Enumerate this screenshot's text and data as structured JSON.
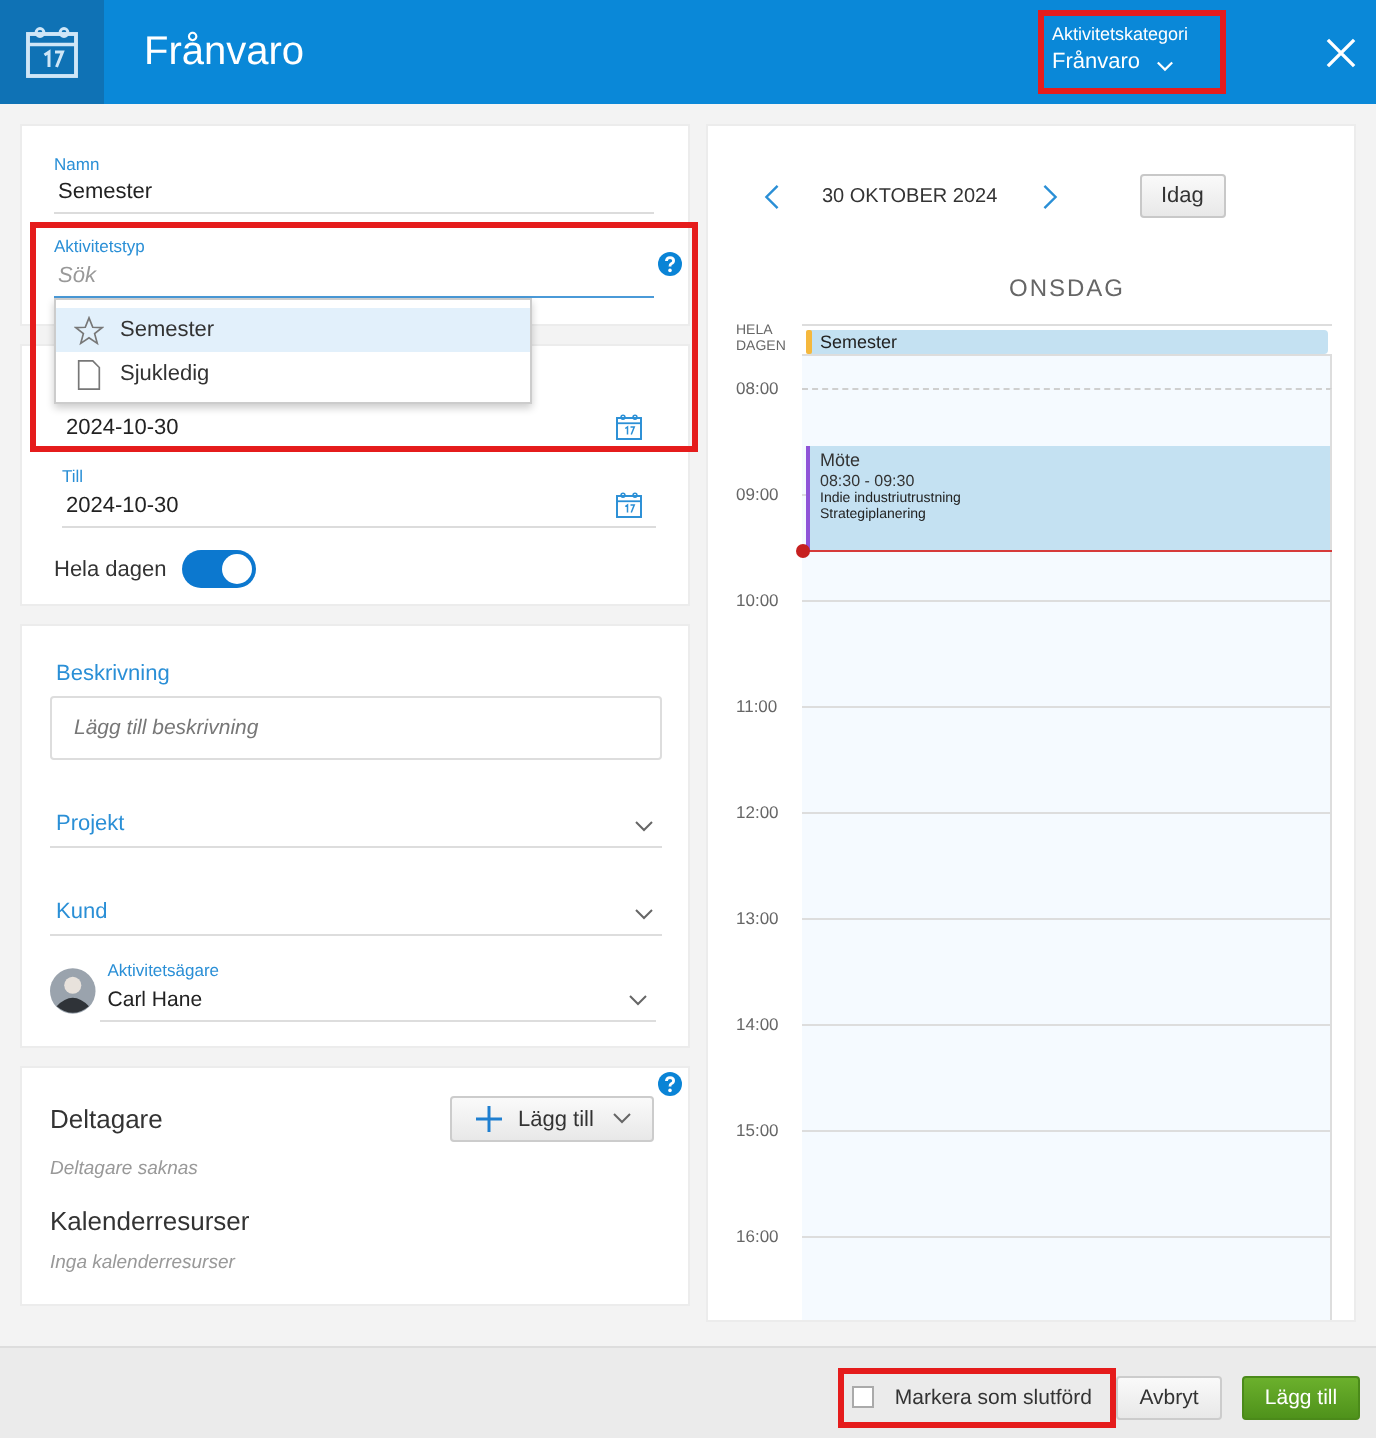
{
  "header": {
    "title": "Frånvaro",
    "category": {
      "label": "Aktivitetskategori",
      "value": "Frånvaro",
      "highlighted": true
    }
  },
  "form": {
    "name": {
      "label": "Namn",
      "value": "Semester"
    },
    "activity_type": {
      "label": "Aktivitetstyp",
      "placeholder": "Sök",
      "highlighted": true,
      "options": [
        {
          "label": "Semester",
          "kind": "star",
          "selected": true
        },
        {
          "label": "Sjukledig",
          "kind": "page",
          "selected": false
        }
      ]
    },
    "from": {
      "value": "2024-10-30"
    },
    "to": {
      "label": "Till",
      "value": "2024-10-30"
    },
    "all_day": {
      "label": "Hela dagen",
      "on": true
    }
  },
  "details": {
    "description": {
      "label": "Beskrivning",
      "placeholder": "Lägg till beskrivning"
    },
    "project": {
      "label": "Projekt"
    },
    "customer": {
      "label": "Kund"
    },
    "owner": {
      "label": "Aktivitetsägare",
      "value": "Carl Hane"
    }
  },
  "participants": {
    "title": "Deltagare",
    "add_button": "Lägg till",
    "empty": "Deltagare saknas",
    "resources_title": "Kalenderresurser",
    "resources_empty": "Inga kalenderresurser"
  },
  "calendar": {
    "date": "30 OKTOBER 2024",
    "today_button": "Idag",
    "weekday": "ONSDAG",
    "all_day_label": "HELA DAGEN",
    "hours": [
      "08:00",
      "09:00",
      "10:00",
      "11:00",
      "12:00",
      "13:00",
      "14:00",
      "15:00",
      "16:00"
    ],
    "all_day_events": [
      {
        "title": "Semester",
        "color": "#f5b83d"
      }
    ],
    "events": [
      {
        "title": "Möte",
        "time": "08:30 - 09:30",
        "lines": [
          "Indie industriutrustning",
          "Strategiplanering"
        ],
        "color": "#8e54d8"
      }
    ]
  },
  "footer": {
    "mark_done": {
      "label": "Markera som slutförd",
      "checked": false,
      "highlighted": true
    },
    "cancel": "Avbryt",
    "add": "Lägg till"
  }
}
